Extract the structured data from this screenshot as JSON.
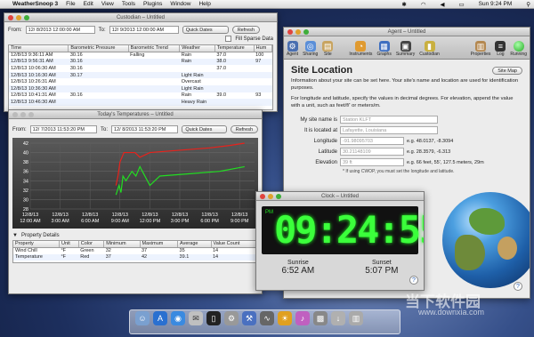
{
  "menubar": {
    "app": "WeatherSnoop 3",
    "items": [
      "File",
      "Edit",
      "View",
      "Tools",
      "Plugins",
      "Window",
      "Help"
    ],
    "clock": "Sun 9:24 PM"
  },
  "custodian": {
    "title": "Custodian – Untitled",
    "from_label": "From:",
    "from_value": "12/ 8/2013 12:00:00 AM",
    "to_label": "To:",
    "to_value": "12/ 9/2013 12:00:00 AM",
    "quick_dates": "Quick Dates",
    "refresh": "Refresh",
    "fill_sparse": "Fill Sparse Data",
    "columns": [
      "Time",
      "Barometric Pressure",
      "Barometric Trend",
      "Weather",
      "Temperature",
      "Hum"
    ],
    "rows": [
      [
        "12/8/13 9:36:11 AM",
        "30.16",
        "Falling",
        "Rain",
        "37.0",
        "100"
      ],
      [
        "12/8/13 9:56:31 AM",
        "30.16",
        "",
        "Rain",
        "38.0",
        "97"
      ],
      [
        "12/8/13 10:06:30 AM",
        "30.16",
        "",
        "",
        "37.0",
        ""
      ],
      [
        "12/8/13 10:16:30 AM",
        "30.17",
        "",
        "Light Rain",
        "",
        ""
      ],
      [
        "12/8/13 10:26:31 AM",
        "",
        "",
        "Overcast",
        "",
        ""
      ],
      [
        "12/8/13 10:36:30 AM",
        "",
        "",
        "Light Rain",
        "",
        ""
      ],
      [
        "12/8/13 10:41:31 AM",
        "30.16",
        "",
        "Rain",
        "39.0",
        "93"
      ],
      [
        "12/8/13 10:46:30 AM",
        "",
        "",
        "Heavy Rain",
        "",
        ""
      ]
    ]
  },
  "temps": {
    "title": "Today's Temperatures – Untitled",
    "from_label": "From:",
    "from_value": "12/ 7/2013 11:53:20 PM",
    "to_label": "To:",
    "to_value": "12/ 8/2013 11:53:20 PM",
    "quick_dates": "Quick Dates",
    "refresh": "Refresh",
    "props_title": "Property Details",
    "prop_columns": [
      "Property",
      "Unit",
      "Color",
      "Minimum",
      "Maximum",
      "Average",
      "Value Count"
    ],
    "prop_rows": [
      [
        "Wind Chill",
        "°F",
        "Green",
        "32",
        "37",
        "35",
        "14"
      ],
      [
        "Temperature",
        "°F",
        "Red",
        "37",
        "42",
        "39.1",
        "14"
      ]
    ]
  },
  "chart_data": {
    "type": "line",
    "x": [
      "12/8/13 12:00 AM",
      "12/8/13 3:00 AM",
      "12/8/13 6:00 AM",
      "12/8/13 9:00 AM",
      "12/8/13 12:00 PM",
      "12/8/13 3:00 PM",
      "12/8/13 6:00 PM",
      "12/8/13 9:00 PM"
    ],
    "ylim": [
      28,
      42
    ],
    "yticks": [
      28,
      30,
      32,
      34,
      36,
      38,
      40,
      42
    ],
    "series": [
      {
        "color": "#e8221c",
        "points": [
          [
            8.6,
            33
          ],
          [
            8.8,
            35
          ],
          [
            9.0,
            38
          ],
          [
            9.4,
            40
          ],
          [
            10.5,
            40
          ],
          [
            11,
            39
          ],
          [
            12,
            40
          ],
          [
            15,
            40.5
          ],
          [
            18,
            41
          ],
          [
            20,
            41.5
          ],
          [
            21.5,
            42
          ]
        ]
      },
      {
        "color": "#22dd22",
        "points": [
          [
            8.6,
            31
          ],
          [
            8.9,
            33
          ],
          [
            9.1,
            31.5
          ],
          [
            9.3,
            35
          ],
          [
            9.6,
            34
          ],
          [
            10.2,
            36
          ],
          [
            10.6,
            35
          ],
          [
            11,
            37
          ],
          [
            12,
            33
          ],
          [
            13,
            35
          ],
          [
            16,
            35.5
          ],
          [
            19,
            36
          ],
          [
            21.5,
            37
          ]
        ]
      }
    ],
    "x_hours": [
      0,
      3,
      6,
      9,
      12,
      15,
      18,
      21
    ]
  },
  "agent": {
    "title": "Agent – Untitled",
    "toolbar": [
      "Agent",
      "Sharing",
      "Site",
      "Instruments",
      "Graphs",
      "Summary",
      "Custodian",
      "Properties",
      "Log",
      "Running"
    ],
    "heading": "Site Location",
    "site_map": "Site Map",
    "intro": "Information about your site can be set here. Your site's name and location are used for identification purposes.",
    "desc": "For longitude and latitude, specify the values in decimal degrees. For elevation, append the value with a unit, such as feet/f/' or meters/m.",
    "fields": [
      {
        "label": "My site name is",
        "value": "Station KLFT",
        "example": ""
      },
      {
        "label": "It is located at",
        "value": "Lafayette, Louisiana",
        "example": ""
      },
      {
        "label": "Longitude",
        "value": "-91.98095703",
        "example": "e.g. 48.0137, -8.3094"
      },
      {
        "label": "Latitude",
        "value": "30.21148109",
        "example": "e.g. 28.3579, -6.313"
      },
      {
        "label": "Elevation",
        "value": "39 ft",
        "example": "e.g. 66 feet, 55', 127.5 meters, 29m"
      }
    ],
    "note": "* If using CWOP, you must set the longitude and latitude."
  },
  "clock": {
    "title": "Clock – Untitled",
    "pm": "PM",
    "time": "09:24:55",
    "sunrise_label": "Sunrise",
    "sunrise": "6:52 AM",
    "sunset_label": "Sunset",
    "sunset": "5:07 PM"
  },
  "watermark": {
    "name": "当下软件园",
    "url": "www.downxia.com"
  }
}
